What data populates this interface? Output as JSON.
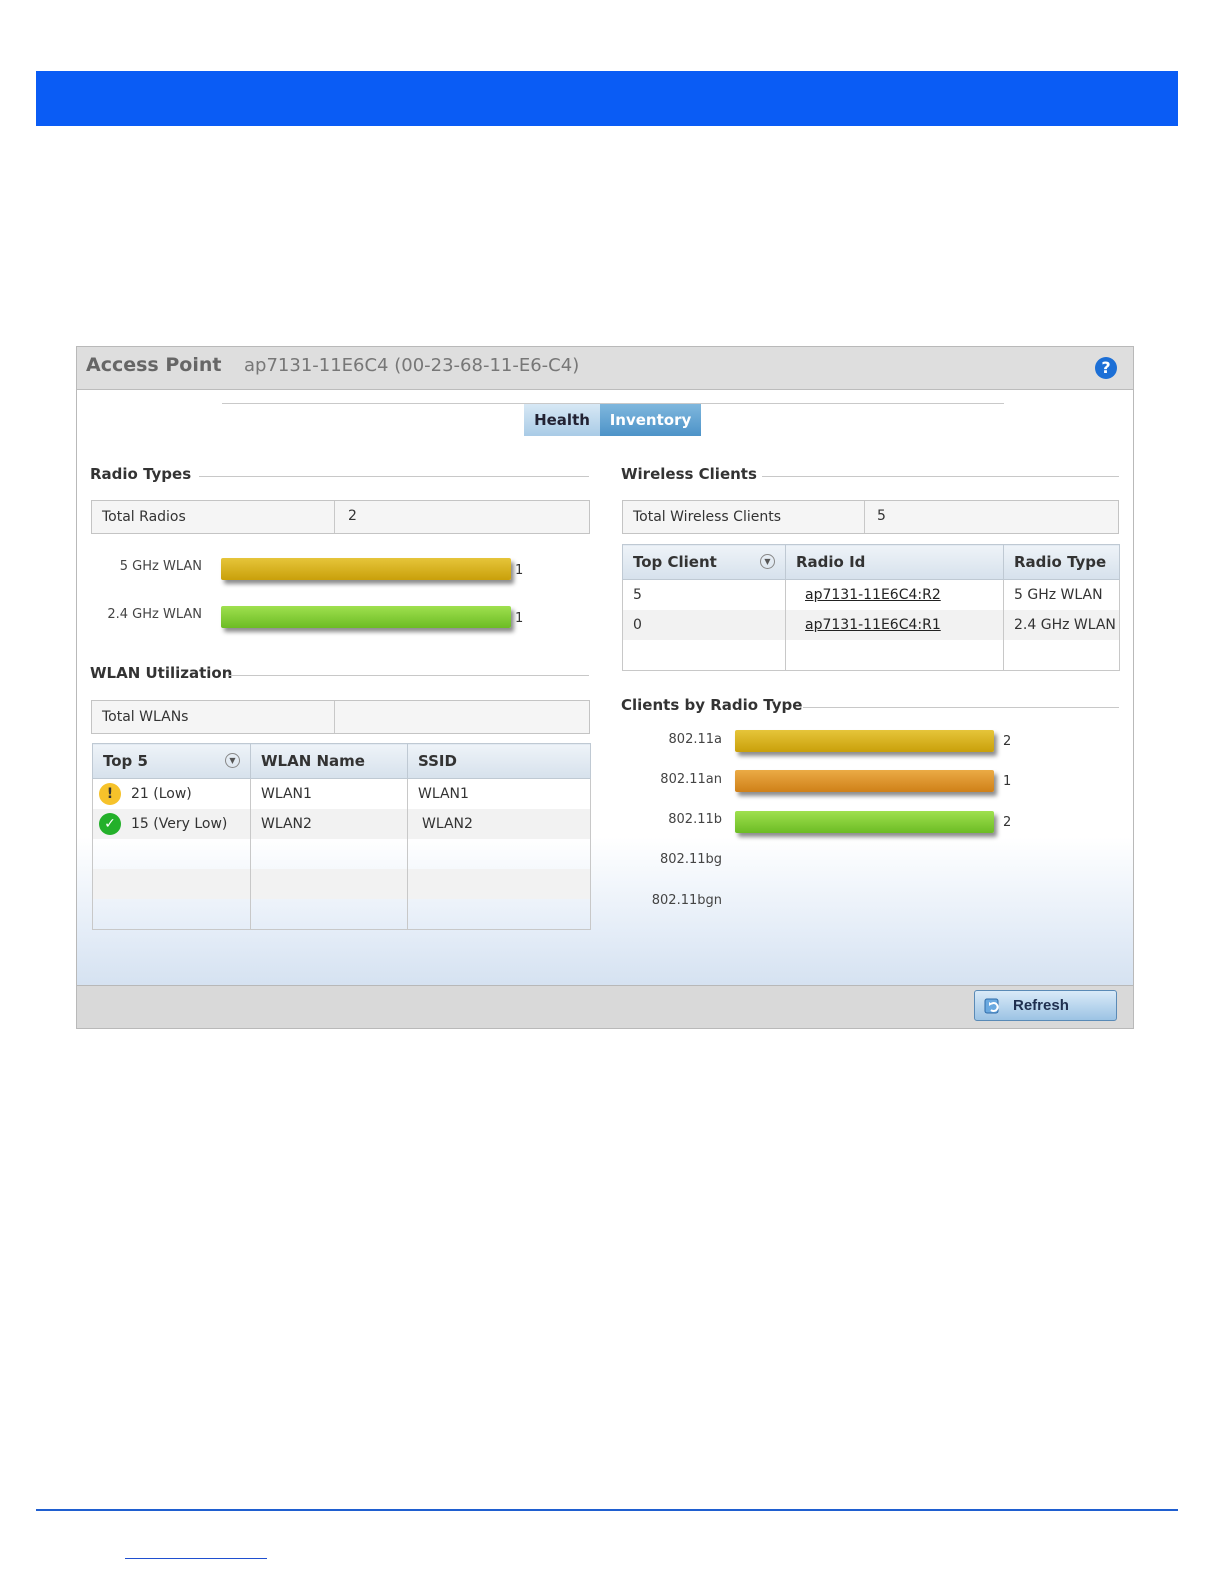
{
  "panel": {
    "title": "Access Point",
    "device": "ap7131-11E6C4 (00-23-68-11-E6-C4)",
    "help_glyph": "?"
  },
  "tabs": [
    {
      "label": "Health"
    },
    {
      "label": "Inventory"
    }
  ],
  "radio_types": {
    "title": "Radio Types",
    "total_label": "Total Radios",
    "total_value": "2",
    "bars": [
      {
        "label": "5 GHz WLAN",
        "value": "1",
        "color": "#dcb412"
      },
      {
        "label": "2.4 GHz WLAN",
        "value": "1",
        "color": "#84d23a"
      }
    ]
  },
  "wlan_utilization": {
    "title": "WLAN Utilization",
    "total_label": "Total WLANs",
    "total_value": "",
    "columns": [
      "Top 5",
      "WLAN Name",
      "SSID"
    ],
    "rows": [
      {
        "status": "warning-icon",
        "top": "21 (Low)",
        "name": "WLAN1",
        "ssid": "WLAN1"
      },
      {
        "status": "check-icon",
        "top": "15 (Very Low)",
        "name": "WLAN2",
        "ssid": "WLAN2"
      }
    ]
  },
  "wireless_clients": {
    "title": "Wireless Clients",
    "total_label": "Total Wireless Clients",
    "total_value": "5",
    "columns": [
      "Top Client",
      "Radio Id",
      "Radio Type"
    ],
    "rows": [
      {
        "top": "5",
        "radio_id": "ap7131-11E6C4:R2",
        "radio_type": "5 GHz WLAN"
      },
      {
        "top": "0",
        "radio_id": "ap7131-11E6C4:R1",
        "radio_type": "2.4 GHz WLAN"
      }
    ]
  },
  "clients_by_radio_type": {
    "title": "Clients by Radio Type",
    "bars": [
      {
        "label": "802.11a",
        "value": "2",
        "color": "#dcb412"
      },
      {
        "label": "802.11an",
        "value": "1",
        "color": "#e0962a"
      },
      {
        "label": "802.11b",
        "value": "2",
        "color": "#84d23a"
      },
      {
        "label": "802.11bg",
        "value": ""
      },
      {
        "label": "802.11bgn",
        "value": ""
      }
    ]
  },
  "footer": {
    "refresh_label": "Refresh"
  },
  "colors": {
    "header_bar": "#0a5cf5",
    "accent": "#1c6fd6"
  }
}
